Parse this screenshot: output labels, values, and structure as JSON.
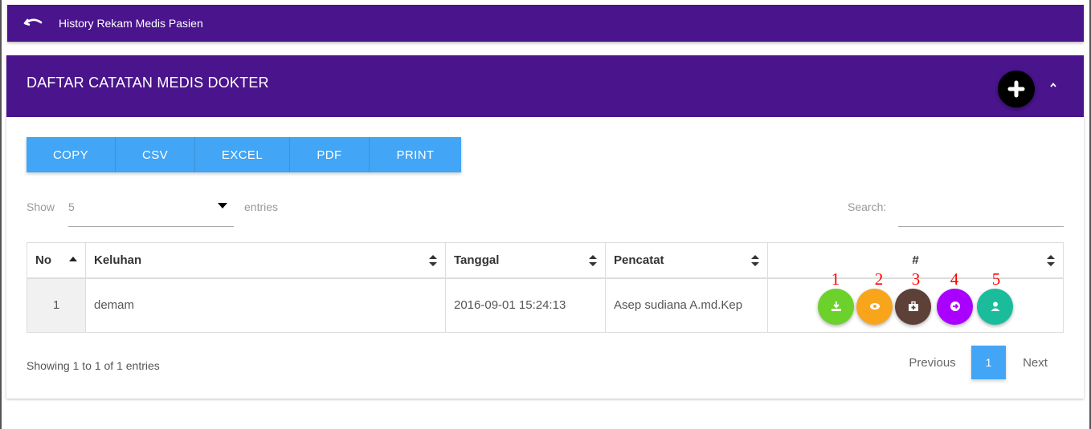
{
  "header": {
    "title": "History Rekam Medis Pasien",
    "back_icon": "undo-icon"
  },
  "card": {
    "title": "DAFTAR CATATAN MEDIS DOKTER",
    "add_icon": "plus-icon",
    "collapse_icon": "chevron-up-icon"
  },
  "export_buttons": [
    "COPY",
    "CSV",
    "EXCEL",
    "PDF",
    "PRINT"
  ],
  "length": {
    "show_label": "Show",
    "value": "5",
    "entries_label": "entries"
  },
  "search": {
    "label": "Search:",
    "value": ""
  },
  "table": {
    "columns": [
      "No",
      "Keluhan",
      "Tanggal",
      "Pencatat",
      "#"
    ],
    "rows": [
      {
        "no": "1",
        "keluhan": "demam",
        "tanggal": "2016-09-01 15:24:13",
        "pencatat": "Asep sudiana A.md.Kep"
      }
    ]
  },
  "actions": [
    {
      "label": "1",
      "icon": "download-icon",
      "color": "#6cd12a"
    },
    {
      "label": "2",
      "icon": "eye-icon",
      "color": "#f8a51c"
    },
    {
      "label": "3",
      "icon": "medical-kit-icon",
      "color": "#5d4037"
    },
    {
      "label": "4",
      "icon": "arrow-right-circle-icon",
      "color": "#aa00ff"
    },
    {
      "label": "5",
      "icon": "user-icon",
      "color": "#1abc9c"
    }
  ],
  "footer": {
    "info": "Showing 1 to 1 of 1 entries",
    "previous": "Previous",
    "current_page": "1",
    "next": "Next"
  },
  "colors": {
    "primary": "#4a148c",
    "accent": "#42a5f5"
  }
}
